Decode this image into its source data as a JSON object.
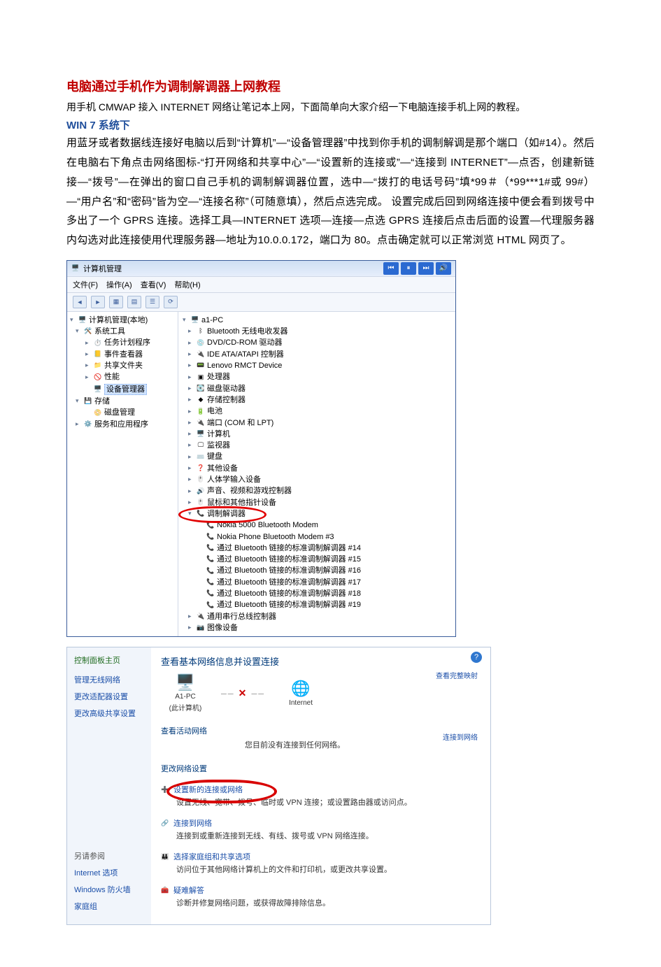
{
  "doc": {
    "title_red": "电脑通过手机作为调制解调器上网教程",
    "intro": "用手机 CMWAP 接入 INTERNET 网络让笔记本上网，下面简单向大家介绍一下电脑连接手机上网的教程。",
    "title_blue": "WIN 7 系统下",
    "body": "用蓝牙或者数据线连接好电脑以后到“计算机”—“设备管理器”中找到你手机的调制解调是那个端口（如#14）。然后在电脑右下角点击网络图标-“打开网络和共享中心”—“设置新的连接或”—“连接到 INTERNET”—点否，创建新链接—“拨号”—在弹出的窗口自己手机的调制解调器位置，选中—“拨打的电话号码”填*99＃（*99***1#或 99#）—“用户名”和“密码”皆为空—“连接名称”（可随意填），然后点选完成。 设置完成后回到网络连接中便会看到拨号中多出了一个 GPRS 连接。选择工具—INTERNET 选项—连接—点选 GPRS 连接后点击后面的设置—代理服务器内勾选对此连接使用代理服务器—地址为10.0.0.172，端口为 80。点击确定就可以正常浏览 HTML 网页了。"
  },
  "cm": {
    "window_title": "计算机管理",
    "menu": [
      "文件(F)",
      "操作(A)",
      "查看(V)",
      "帮助(H)"
    ],
    "left_tree": {
      "root": "计算机管理(本地)",
      "sys_tools": "系统工具",
      "items": [
        "任务计划程序",
        "事件查看器",
        "共享文件夹",
        "性能",
        "设备管理器"
      ],
      "storage": "存储",
      "disk": "磁盘管理",
      "services": "服务和应用程序"
    },
    "right_tree": {
      "root": "a1-PC",
      "items": [
        "Bluetooth 无线电收发器",
        "DVD/CD-ROM 驱动器",
        "IDE ATA/ATAPI 控制器",
        "Lenovo RMCT Device",
        "处理器",
        "磁盘驱动器",
        "存储控制器",
        "电池",
        "端口 (COM 和 LPT)",
        "计算机",
        "监视器",
        "键盘",
        "其他设备",
        "人体学输入设备",
        "声音、视频和游戏控制器",
        "鼠标和其他指针设备"
      ],
      "modems_label": "调制解调器",
      "modems": [
        "Nokia 5000 Bluetooth Modem",
        "Nokia Phone Bluetooth Modem #3",
        "通过 Bluetooth 链接的标准调制解调器 #14",
        "通过 Bluetooth 链接的标准调制解调器 #15",
        "通过 Bluetooth 链接的标准调制解调器 #16",
        "通过 Bluetooth 链接的标准调制解调器 #17",
        "通过 Bluetooth 链接的标准调制解调器 #18",
        "通过 Bluetooth 链接的标准调制解调器 #19"
      ],
      "tail": [
        "通用串行总线控制器",
        "图像设备"
      ]
    }
  },
  "nc": {
    "left": {
      "home": "控制面板主页",
      "links": [
        "管理无线网络",
        "更改适配器设置",
        "更改高级共享设置"
      ],
      "see_also_hdr": "另请参阅",
      "see_also": [
        "Internet 选项",
        "Windows 防火墙",
        "家庭组"
      ]
    },
    "right": {
      "title": "查看基本网络信息并设置连接",
      "map_link": "查看完整映射",
      "pc_name": "A1-PC",
      "pc_sub": "(此计算机)",
      "internet": "Internet",
      "active_hdr": "查看活动网络",
      "active_none": "您目前没有连接到任何网络。",
      "connect_link": "连接到网络",
      "change_hdr": "更改网络设置",
      "tasks": [
        {
          "title": "设置新的连接或网络",
          "desc": "设置无线、宽带、拨号、临时或 VPN 连接；或设置路由器或访问点。"
        },
        {
          "title": "连接到网络",
          "desc": "连接到或重新连接到无线、有线、拨号或 VPN 网络连接。"
        },
        {
          "title": "选择家庭组和共享选项",
          "desc": "访问位于其他网络计算机上的文件和打印机，或更改共享设置。"
        },
        {
          "title": "疑难解答",
          "desc": "诊断并修复网络问题，或获得故障排除信息。"
        }
      ]
    }
  }
}
